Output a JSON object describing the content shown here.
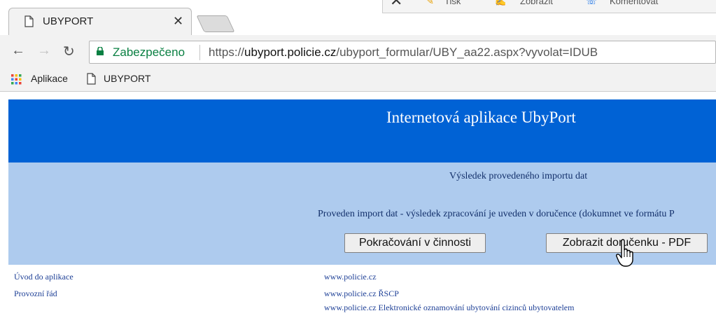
{
  "browser": {
    "tab": {
      "title": "UBYPORT",
      "close_glyph": "✕"
    },
    "toolbar_fragment": [
      "Tisk",
      "Zobrazit",
      "Komentovat"
    ],
    "address_bar": {
      "security_label": "Zabezpečeno",
      "url_scheme": "https://",
      "url_host": "ubyport.policie.cz",
      "url_path": "/ubyport_formular/UBY_aa22.aspx?vyvolat=IDUB"
    },
    "bookmarks": [
      {
        "label": "Aplikace",
        "icon": "apps-grid-icon"
      },
      {
        "label": "UBYPORT",
        "icon": "page-icon"
      }
    ]
  },
  "page": {
    "app_title": "Internetová aplikace UbyPort",
    "result_heading": "Výsledek provedeného importu dat",
    "result_message": "Proveden import dat - výsledek zpracování je uveden v doručence (dokumnet ve formátu P",
    "buttons": {
      "continue_label": "Pokračování v činnosti",
      "pdf_label": "Zobrazit doručenku - PDF"
    },
    "footer_links": {
      "left": [
        "Úvod do aplikace",
        "Provozní řád"
      ],
      "right": [
        "www.policie.cz",
        "www.policie.cz ŘSCP",
        "www.policie.cz Elektronické oznamování ubytování cizinců ubytovatelem"
      ]
    }
  },
  "colors": {
    "banner": "#0062d5",
    "content_bg": "#aecbee",
    "text_dark_blue": "#13306b",
    "link": "#1d3f96",
    "secure_green": "#0b8043"
  }
}
